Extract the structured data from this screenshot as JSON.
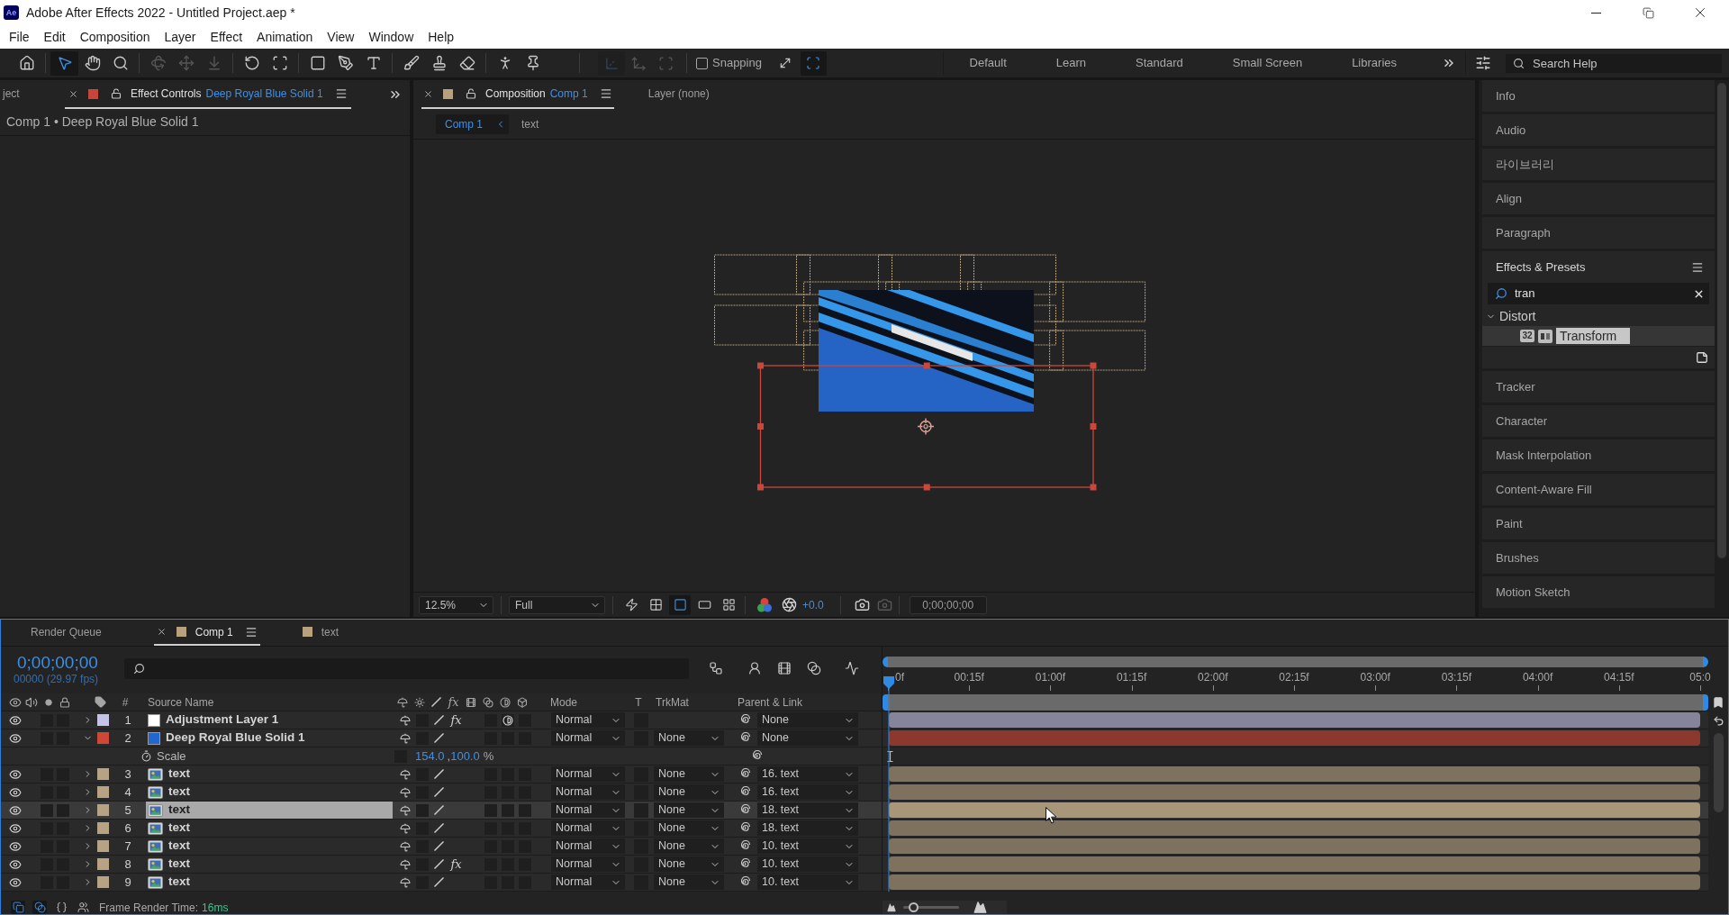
{
  "window": {
    "app_badge": "Ae",
    "title": "Adobe After Effects 2022 - Untitled Project.aep *"
  },
  "menu": [
    "File",
    "Edit",
    "Composition",
    "Layer",
    "Effect",
    "Animation",
    "View",
    "Window",
    "Help"
  ],
  "toolbar": {
    "tools": [
      {
        "kind": "home",
        "selected": false,
        "disabled": false
      },
      {
        "kind": "selection",
        "selected": true,
        "disabled": false
      },
      {
        "kind": "hand",
        "selected": false,
        "disabled": false
      },
      {
        "kind": "zoom",
        "selected": false,
        "disabled": false
      },
      {
        "kind": "orbit",
        "selected": false,
        "disabled": true
      },
      {
        "kind": "pan",
        "selected": false,
        "disabled": true
      },
      {
        "kind": "dolly",
        "selected": false,
        "disabled": true
      },
      {
        "kind": "rotate",
        "selected": false,
        "disabled": false
      },
      {
        "kind": "pan_behind",
        "selected": false,
        "disabled": false
      },
      {
        "kind": "shape",
        "selected": false,
        "disabled": false
      },
      {
        "kind": "pen",
        "selected": false,
        "disabled": false
      },
      {
        "kind": "type",
        "selected": false,
        "disabled": false
      },
      {
        "kind": "brush",
        "selected": false,
        "disabled": false
      },
      {
        "kind": "clone_stamp",
        "selected": false,
        "disabled": false
      },
      {
        "kind": "eraser",
        "selected": false,
        "disabled": false
      },
      {
        "kind": "roto_brush",
        "selected": false,
        "disabled": false
      },
      {
        "kind": "puppet_pin",
        "selected": false,
        "disabled": false
      }
    ],
    "axis_modes": [
      {
        "kind": "local",
        "selected": true,
        "disabled": true
      },
      {
        "kind": "world",
        "selected": false,
        "disabled": true
      },
      {
        "kind": "view",
        "selected": false,
        "disabled": true
      }
    ],
    "snapping": {
      "label": "Snapping",
      "checked": false
    },
    "snap_options": [
      {
        "kind": "extend",
        "selected": false
      },
      {
        "kind": "features",
        "selected": true
      }
    ]
  },
  "workspaces": [
    "Default",
    "Learn",
    "Standard",
    "Small Screen",
    "Libraries"
  ],
  "search_help": {
    "placeholder": "Search Help"
  },
  "effect_controls": {
    "tabs": [
      {
        "label": "ject",
        "selected": false,
        "closable": false
      },
      {
        "label": "Effect Controls",
        "subject": "Deep Royal Blue Solid 1",
        "color": "#c8453b",
        "locked": false,
        "selected": true,
        "closable": true
      }
    ],
    "breadcrumb": "Comp 1 • Deep Royal Blue Solid 1"
  },
  "composition": {
    "tabs": [
      {
        "label": "Composition",
        "subject": "Comp 1",
        "color": "#b8a17f",
        "locked": false,
        "selected": true,
        "closable": true
      },
      {
        "label": "Layer (none)",
        "selected": false,
        "closable": false
      }
    ],
    "breadcrumbs": [
      {
        "label": "Comp 1",
        "selected": true
      },
      {
        "label": "text",
        "selected": false
      }
    ],
    "footer": {
      "zoom": "12.5%",
      "resolution": "Full",
      "view_toggles": [
        {
          "kind": "fast_previews",
          "selected": false
        },
        {
          "kind": "transparency_grid",
          "selected": false
        },
        {
          "kind": "mask_path",
          "selected": true
        },
        {
          "kind": "region_of_interest",
          "selected": false
        },
        {
          "kind": "grid",
          "selected": false
        }
      ],
      "exposure": "+0.0",
      "timecode": "0;00;00;00"
    }
  },
  "panels": [
    {
      "kind": "collapsed",
      "title": "Info"
    },
    {
      "kind": "collapsed",
      "title": "Audio"
    },
    {
      "kind": "collapsed",
      "title": "라이브러리"
    },
    {
      "kind": "collapsed",
      "title": "Align"
    },
    {
      "kind": "collapsed",
      "title": "Paragraph"
    },
    {
      "kind": "effects",
      "title": "Effects & Presets",
      "search": "tran",
      "tree": [
        {
          "label": "Distort",
          "expanded": true,
          "children": [
            {
              "label": "Transform",
              "badge": "32",
              "selected": true
            }
          ]
        }
      ]
    },
    {
      "kind": "collapsed",
      "title": "Tracker"
    },
    {
      "kind": "collapsed",
      "title": "Character"
    },
    {
      "kind": "collapsed",
      "title": "Mask Interpolation"
    },
    {
      "kind": "collapsed",
      "title": "Content-Aware Fill"
    },
    {
      "kind": "collapsed",
      "title": "Paint"
    },
    {
      "kind": "collapsed",
      "title": "Brushes"
    },
    {
      "kind": "collapsed",
      "title": "Motion Sketch"
    }
  ],
  "timeline": {
    "tabs": [
      {
        "label": "Render Queue",
        "selected": false,
        "closable": false
      },
      {
        "label": "Comp 1",
        "color": "#b8a17f",
        "selected": true,
        "closable": true
      },
      {
        "label": "text",
        "color": "#b8a17f",
        "selected": false,
        "closable": false
      }
    ],
    "timecode": "0;00;00;00",
    "frame_info": "00000 (29.97 fps)",
    "tools": [
      {
        "kind": "flowchart",
        "selected": false
      },
      {
        "kind": "shy",
        "selected": false
      },
      {
        "kind": "frame_blending",
        "selected": false
      },
      {
        "kind": "motion_blur",
        "selected": false
      },
      {
        "kind": "graph_editor",
        "selected": false
      }
    ],
    "header": {
      "number": "#",
      "source_name": "Source Name",
      "fx": "fx",
      "mode": "Mode",
      "t": "T",
      "trkmat": "TrkMat",
      "parent": "Parent & Link"
    },
    "layers": [
      {
        "number": "1",
        "name": "Adjustment Layer 1",
        "color": "#c4c2e6",
        "source": {
          "kind": "adjustment",
          "color": "#ffffff"
        },
        "visible": true,
        "expanded": false,
        "selected": false,
        "fx": "fx",
        "adjustment": true,
        "mode": "Normal",
        "parent": "None"
      },
      {
        "number": "2",
        "name": "Deep Royal Blue Solid 1",
        "color": "#d04637",
        "source": {
          "kind": "solid",
          "color": "#2466d0"
        },
        "visible": true,
        "expanded": true,
        "selected": false,
        "adjustment": false,
        "mode": "Normal",
        "trkmat": "None",
        "parent": "None",
        "properties": [
          {
            "name": "Scale",
            "values": [
              "154.0",
              "100.0"
            ],
            "separator": ",",
            "unit": "%"
          }
        ]
      },
      {
        "number": "3",
        "name": "text",
        "color": "#b7a383",
        "source": {
          "kind": "footage"
        },
        "visible": true,
        "expanded": false,
        "selected": false,
        "adjustment": false,
        "mode": "Normal",
        "trkmat": "None",
        "parent": "16. text"
      },
      {
        "number": "4",
        "name": "text",
        "color": "#b7a383",
        "source": {
          "kind": "footage"
        },
        "visible": true,
        "expanded": false,
        "selected": false,
        "adjustment": false,
        "mode": "Normal",
        "trkmat": "None",
        "parent": "16. text"
      },
      {
        "number": "5",
        "name": "text",
        "color": "#b7a383",
        "source": {
          "kind": "footage"
        },
        "visible": true,
        "expanded": false,
        "selected": true,
        "adjustment": false,
        "mode": "Normal",
        "trkmat": "None",
        "parent": "18. text"
      },
      {
        "number": "6",
        "name": "text",
        "color": "#b7a383",
        "source": {
          "kind": "footage"
        },
        "visible": true,
        "expanded": false,
        "selected": false,
        "adjustment": false,
        "mode": "Normal",
        "trkmat": "None",
        "parent": "18. text"
      },
      {
        "number": "7",
        "name": "text",
        "color": "#b7a383",
        "source": {
          "kind": "footage"
        },
        "visible": true,
        "expanded": false,
        "selected": false,
        "adjustment": false,
        "mode": "Normal",
        "trkmat": "None",
        "parent": "10. text"
      },
      {
        "number": "8",
        "name": "text",
        "color": "#b7a383",
        "source": {
          "kind": "footage"
        },
        "visible": true,
        "expanded": false,
        "selected": false,
        "fx": "fx",
        "adjustment": false,
        "mode": "Normal",
        "trkmat": "None",
        "parent": "10. text"
      },
      {
        "number": "9",
        "name": "text",
        "color": "#b7a383",
        "source": {
          "kind": "footage"
        },
        "visible": true,
        "expanded": false,
        "selected": false,
        "adjustment": false,
        "mode": "Normal",
        "trkmat": "None",
        "parent": "10. text"
      }
    ],
    "ruler": [
      "0f",
      "00:15f",
      "01:00f",
      "01:15f",
      "02:00f",
      "02:15f",
      "03:00f",
      "03:15f",
      "04:00f",
      "04:15f",
      "05:0"
    ],
    "panes": [
      {
        "kind": "switches",
        "selected": true
      },
      {
        "kind": "modes",
        "selected": true
      },
      {
        "kind": "in_out",
        "selected": false
      },
      {
        "kind": "render_time",
        "selected": false
      }
    ],
    "status": {
      "label": "Frame Render Time:",
      "value": "16ms"
    },
    "zoom_slider": {
      "level": 0.18
    }
  }
}
